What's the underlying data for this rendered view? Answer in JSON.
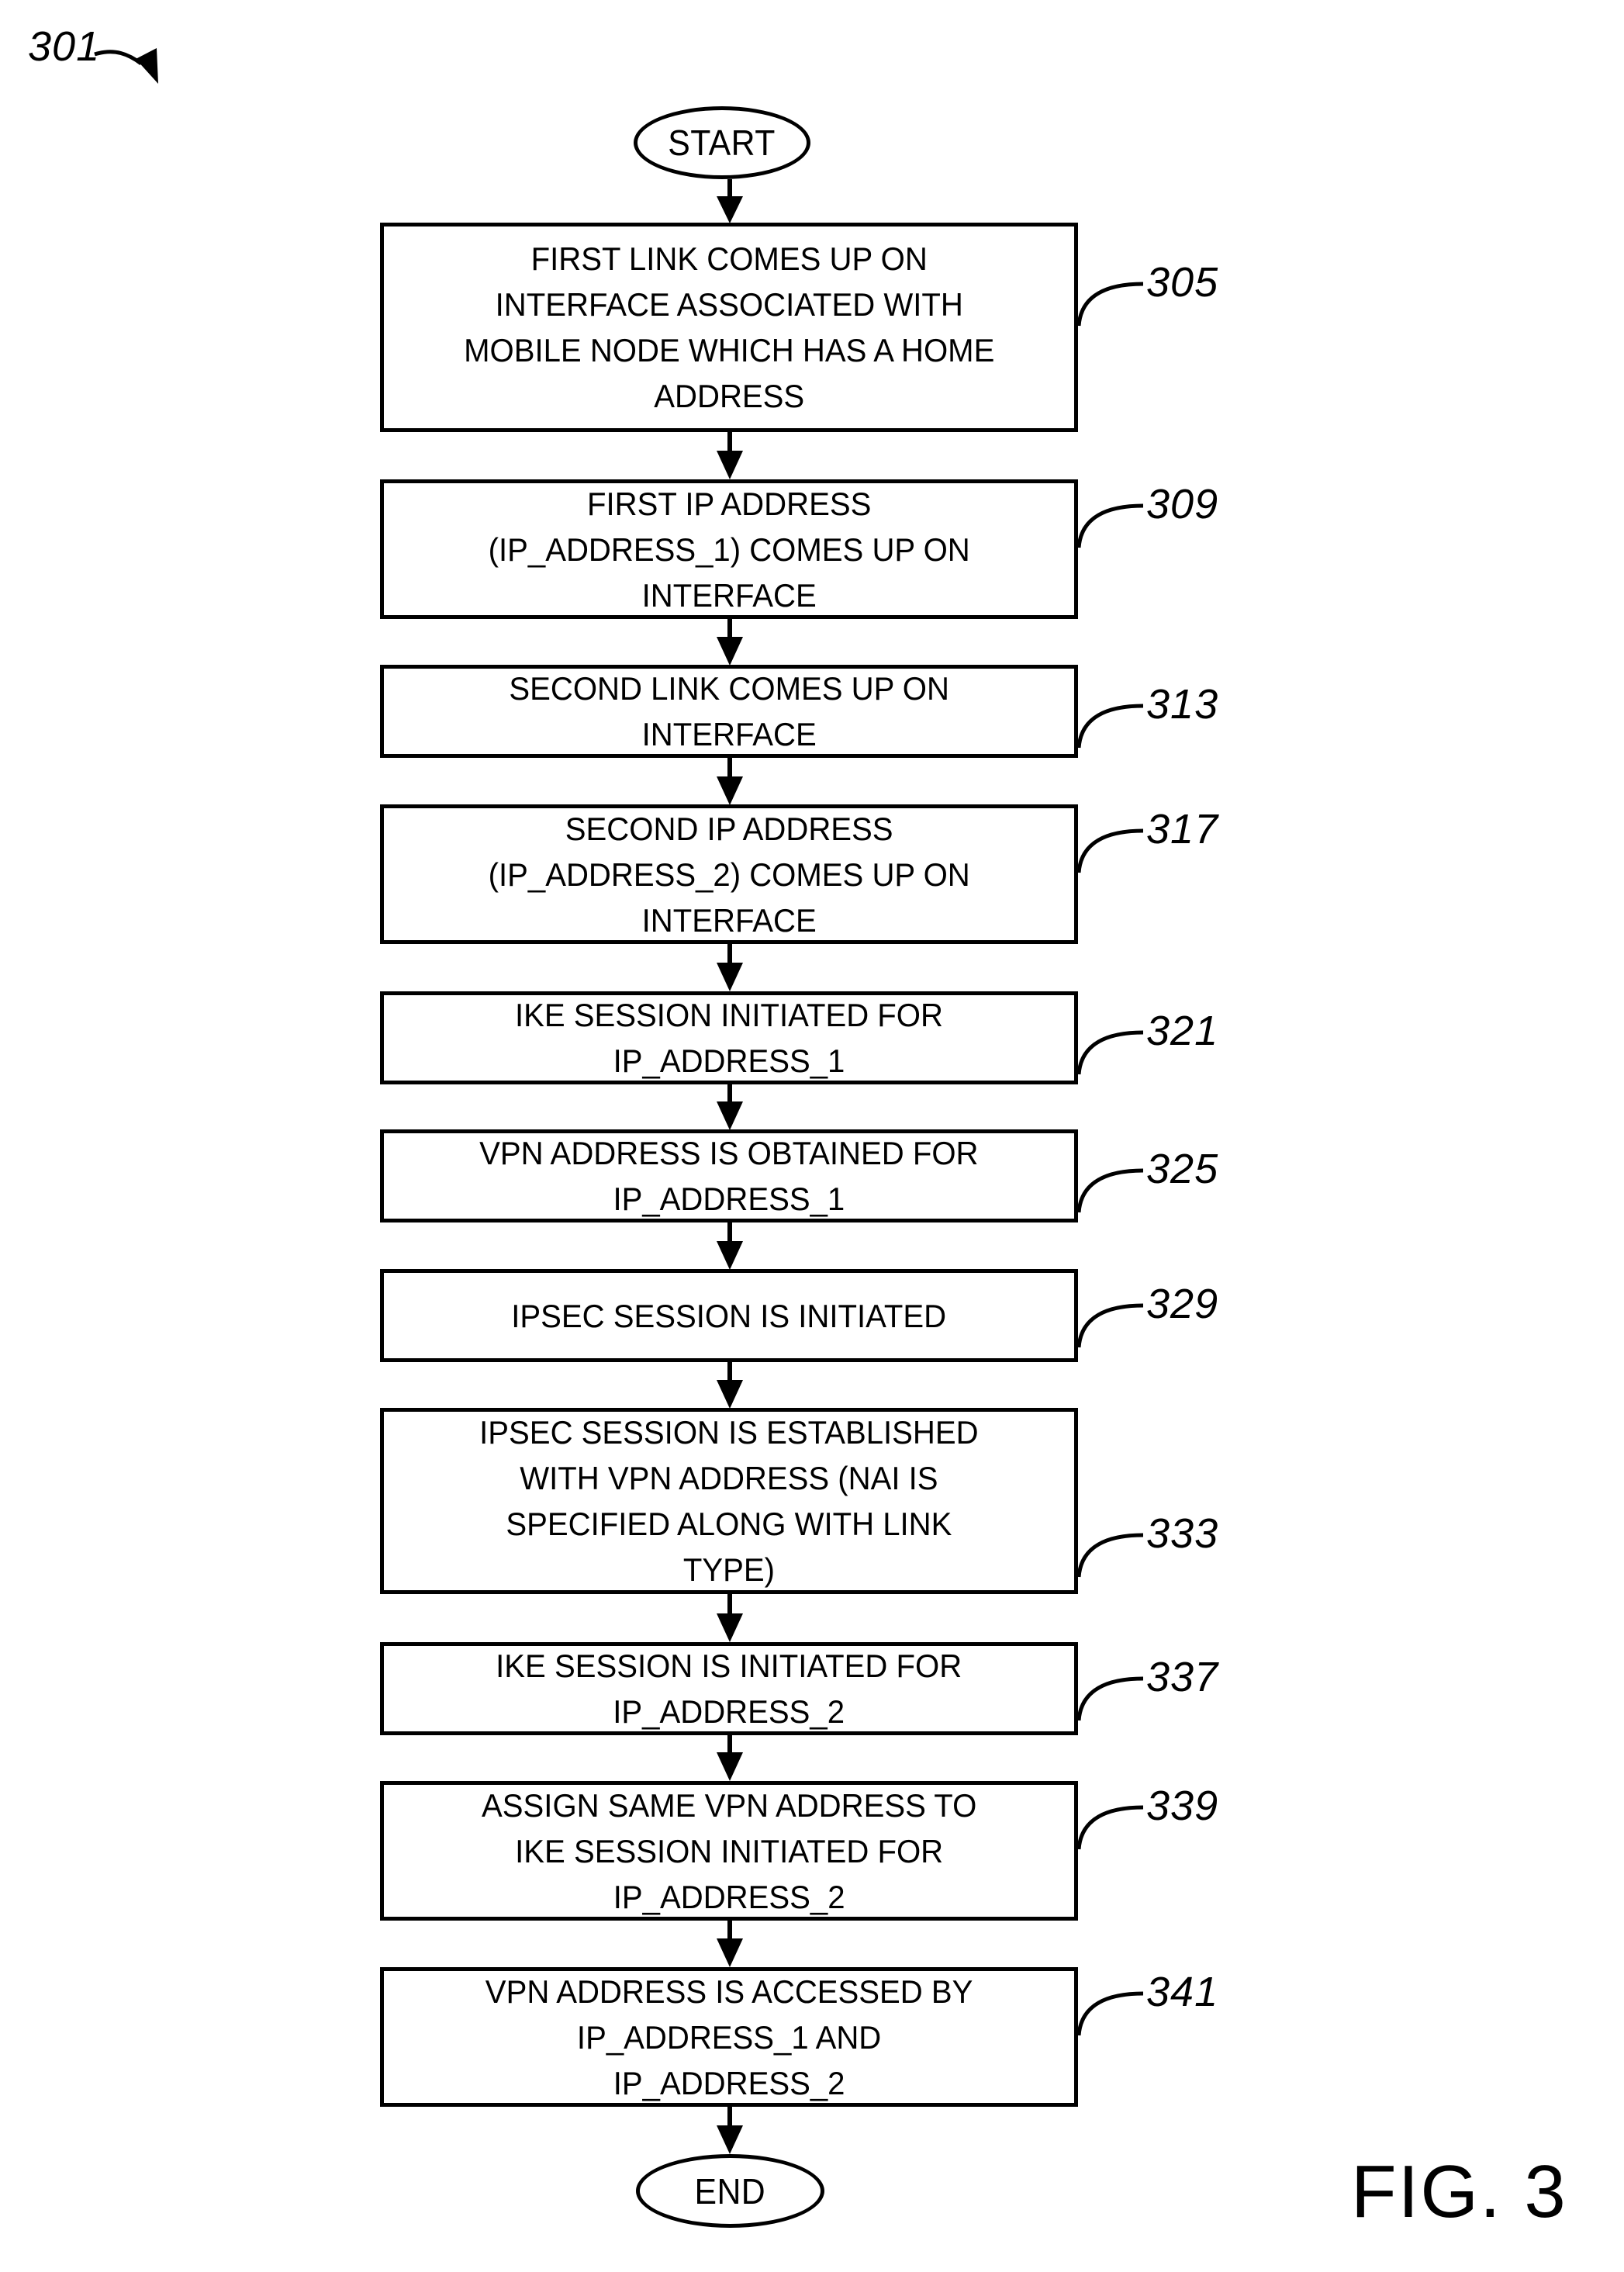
{
  "figure": {
    "sheet_reference": "301",
    "caption": "FIG. 3"
  },
  "terminals": {
    "start": "START",
    "end": "END"
  },
  "flowchart": {
    "type": "flowchart",
    "orientation": "top-to-bottom",
    "steps": [
      {
        "ref": "305",
        "text": "FIRST LINK COMES UP ON\nINTERFACE ASSOCIATED WITH\nMOBILE NODE WHICH HAS A HOME\nADDRESS"
      },
      {
        "ref": "309",
        "text": "FIRST IP ADDRESS\n(IP_ADDRESS_1) COMES UP ON\nINTERFACE"
      },
      {
        "ref": "313",
        "text": "SECOND LINK COMES UP ON\nINTERFACE"
      },
      {
        "ref": "317",
        "text": "SECOND IP ADDRESS\n(IP_ADDRESS_2) COMES UP ON\nINTERFACE"
      },
      {
        "ref": "321",
        "text": "IKE SESSION INITIATED FOR\nIP_ADDRESS_1"
      },
      {
        "ref": "325",
        "text": "VPN ADDRESS IS OBTAINED FOR\nIP_ADDRESS_1"
      },
      {
        "ref": "329",
        "text": "IPSEC SESSION IS INITIATED"
      },
      {
        "ref": "333",
        "text": "IPSEC SESSION IS ESTABLISHED\nWITH VPN ADDRESS (NAI IS\nSPECIFIED ALONG WITH LINK\nTYPE)"
      },
      {
        "ref": "337",
        "text": "IKE SESSION IS INITIATED FOR\nIP_ADDRESS_2"
      },
      {
        "ref": "339",
        "text": "ASSIGN SAME VPN ADDRESS TO\nIKE SESSION INITIATED FOR\nIP_ADDRESS_2"
      },
      {
        "ref": "341",
        "text": "VPN ADDRESS IS ACCESSED BY\nIP_ADDRESS_1 AND\nIP_ADDRESS_2"
      }
    ]
  },
  "colors": {
    "ink": "#000000",
    "background": "#ffffff"
  }
}
